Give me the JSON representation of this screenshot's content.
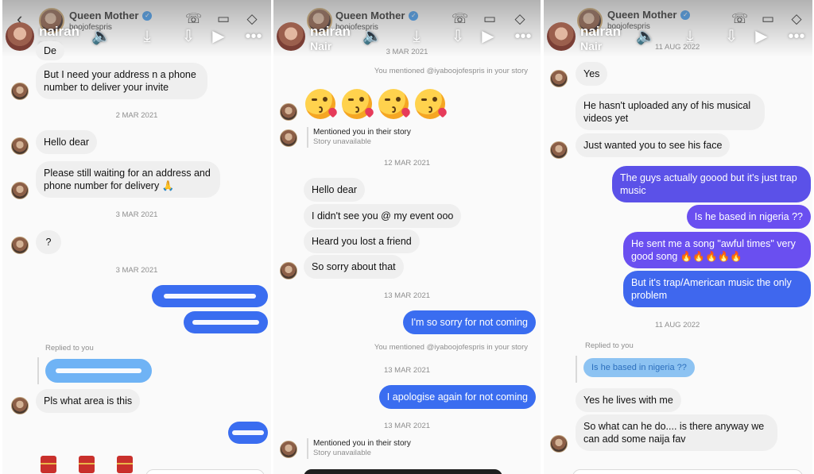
{
  "header": {
    "title": "Queen Mother",
    "username": "@iyaboojofespris",
    "username_fragment": "boojofespris",
    "overlay_name": "nairan",
    "overlay_sub": "Nair"
  },
  "panel1": {
    "top_partial": "De",
    "msg_address": "But I need your address n a phone number to deliver your invite",
    "date_1": "2 MAR 2021",
    "msg_hello": "Hello dear",
    "msg_waiting": "Please still waiting for an address and phone number for delivery 🙏",
    "date_2": "3 MAR 2021",
    "msg_question": "?",
    "date_3": "3 MAR 2021",
    "replied_label": "Replied to you",
    "msg_area": "Pls what area is this"
  },
  "panel2": {
    "date_top": "3 MAR 2021",
    "mention_1": "You mentioned @iyaboojofespris in your story",
    "story_1_title": "Mentioned you in their story",
    "story_1_sub": "Story unavailable",
    "date_1": "12 MAR 2021",
    "msg_hello": "Hello dear",
    "msg_event": "I didn't see you @ my event ooo",
    "msg_friend": "Heard you lost a friend",
    "msg_sorry": "So sorry about that",
    "date_2": "13 MAR 2021",
    "msg_not_coming": "I'm so sorry for not coming",
    "mention_2": "You mentioned @iyaboojofespris in your story",
    "date_3": "13 MAR 2021",
    "msg_apologise": "I apologise again for not coming",
    "date_4": "13 MAR 2021",
    "story_2_title": "Mentioned you in their story",
    "story_2_sub": "Story unavailable"
  },
  "panel3": {
    "date_top": "11 AUG 2022",
    "msg_yes": "Yes",
    "msg_uploaded": "He hasn't uploaded any of his musical videos yet",
    "msg_face": "Just wanted you to see his face",
    "msg_guys": "The guys actually goood but it's just trap music",
    "msg_based": "Is he based in nigeria ??",
    "msg_song": "He sent me a song \"awful times\" very good song 🔥🔥🔥🔥🔥",
    "msg_trap": "But it's trap/American music the only problem",
    "date_2": "11 AUG 2022",
    "replied_label": "Replied to you",
    "reply_quote": "Is he based in nigeria ??",
    "msg_lives": "Yes he lives with me",
    "msg_what": "So what can he do.... is there anyway we can add some naija fav"
  },
  "colors": {
    "accent_blue": "#3a6df0",
    "accent_purple": "#5b51e8",
    "incoming_gray": "#efefef"
  }
}
